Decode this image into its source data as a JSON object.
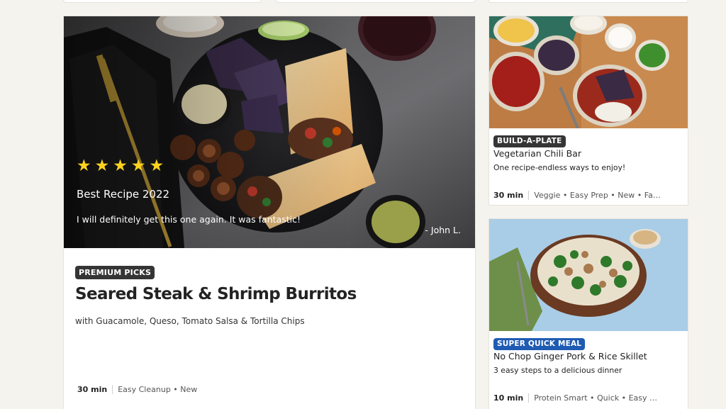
{
  "featured": {
    "review": {
      "stars": [
        "★",
        "★",
        "★",
        "★",
        "★"
      ],
      "title": "Best Recipe 2022",
      "quote": "I will definitely get this one again. It was fantastic!",
      "author": "- John L."
    },
    "badge": "PREMIUM PICKS",
    "title": "Seared Steak & Shrimp Burritos",
    "subtitle": "with Guacamole, Queso, Tomato Salsa & Tortilla Chips",
    "time": "30 min",
    "tags": "Easy Cleanup • New"
  },
  "cards": [
    {
      "badge": "BUILD-A-PLATE",
      "title": "Vegetarian Chili Bar",
      "subtitle": "One recipe-endless ways to enjoy!",
      "time": "30 min",
      "tags": "Veggie • Easy Prep • New • Fam..."
    },
    {
      "badge": "SUPER QUICK MEAL",
      "title": "No Chop Ginger Pork & Rice Skillet",
      "subtitle": "3 easy steps to a delicious dinner",
      "time": "10 min",
      "tags": "Protein Smart • Quick • Easy Pr..."
    }
  ],
  "colors": {
    "star": "#ffd21f",
    "badge_dark": "#353535",
    "badge_blue": "#1f5bb3",
    "page_bg": "#f5f3ee"
  }
}
